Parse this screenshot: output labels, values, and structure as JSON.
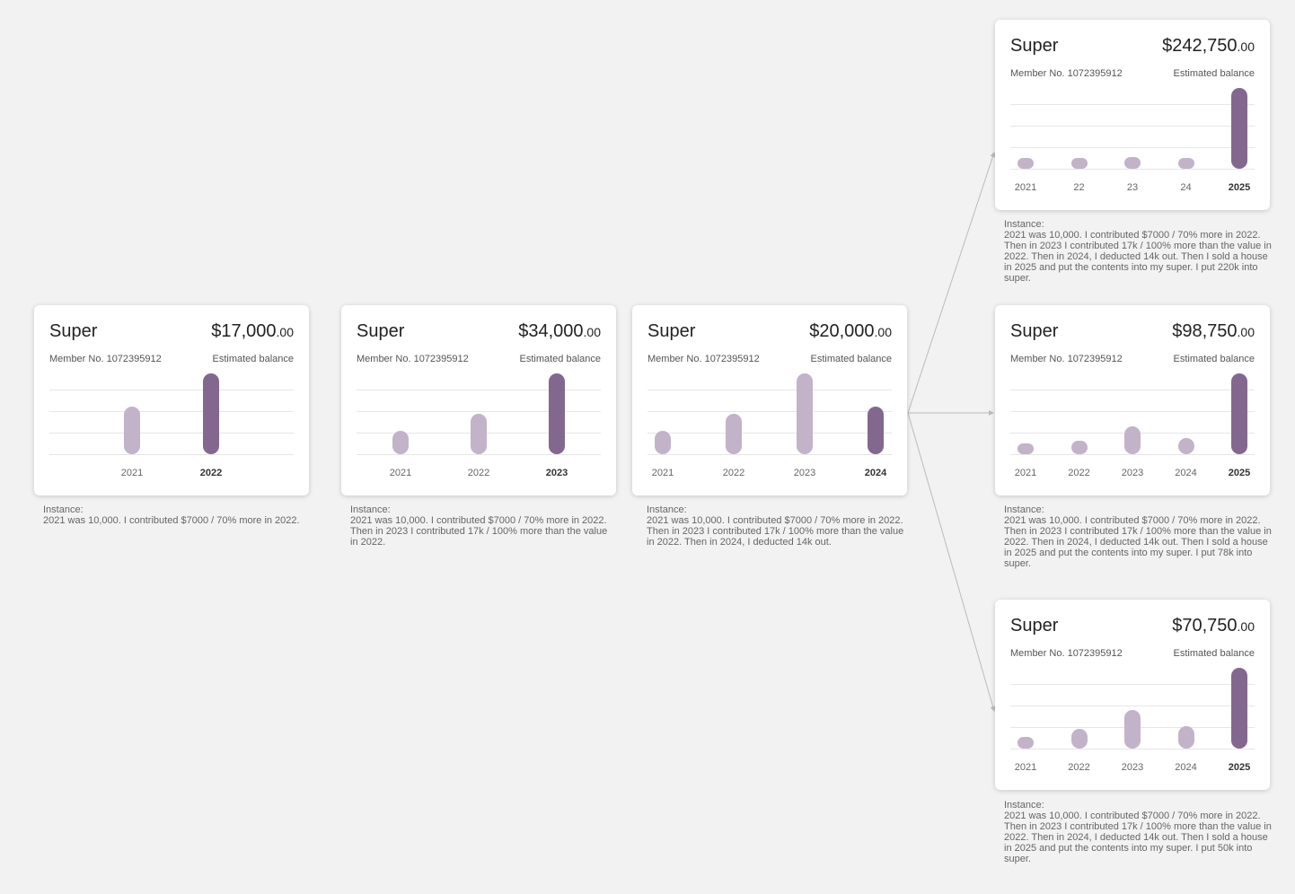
{
  "colors": {
    "bar_past": "#c2b3c9",
    "bar_current": "#82688f",
    "connector": "#bbbbbb"
  },
  "cards": [
    {
      "title": "Super",
      "balance_main": "$17,000",
      "balance_cents": ".00",
      "member": "Member No. 1072395912",
      "estimated": "Estimated balance",
      "note_label": "Instance:",
      "note_text": "2021 was 10,000. I contributed $7000 / 70% more in 2022.",
      "chart_data": {
        "type": "bar",
        "categories": [
          "2021",
          "2022"
        ],
        "values": [
          10000,
          17000
        ]
      }
    },
    {
      "title": "Super",
      "balance_main": "$34,000",
      "balance_cents": ".00",
      "member": "Member No. 1072395912",
      "estimated": "Estimated balance",
      "note_label": "Instance:",
      "note_text": "2021 was 10,000. I contributed $7000 / 70% more in 2022. Then in 2023 I contributed 17k / 100% more than the value in 2022.",
      "chart_data": {
        "type": "bar",
        "categories": [
          "2021",
          "2022",
          "2023"
        ],
        "values": [
          10000,
          17000,
          34000
        ]
      }
    },
    {
      "title": "Super",
      "balance_main": "$20,000",
      "balance_cents": ".00",
      "member": "Member No. 1072395912",
      "estimated": "Estimated balance",
      "note_label": "Instance:",
      "note_text": "2021 was 10,000. I contributed $7000 / 70% more in 2022. Then in 2023 I contributed 17k / 100% more than the value in 2022. Then in 2024, I deducted 14k out.",
      "chart_data": {
        "type": "bar",
        "categories": [
          "2021",
          "2022",
          "2023",
          "2024"
        ],
        "values": [
          10000,
          17000,
          34000,
          20000
        ]
      }
    },
    {
      "title": "Super",
      "balance_main": "$242,750",
      "balance_cents": ".00",
      "member": "Member No. 1072395912",
      "estimated": "Estimated balance",
      "note_label": "Instance:",
      "note_text": "2021 was 10,000. I contributed $7000 / 70% more in 2022. Then in 2023 I contributed 17k / 100% more than the value in 2022. Then in 2024, I deducted 14k out. Then I sold a house in 2025 and put the contents into my super. I put 220k into super.",
      "chart_data": {
        "type": "bar",
        "categories": [
          "2021",
          "22",
          "23",
          "24",
          "2025"
        ],
        "values": [
          10000,
          17000,
          34000,
          20000,
          242750
        ]
      }
    },
    {
      "title": "Super",
      "balance_main": "$98,750",
      "balance_cents": ".00",
      "member": "Member No. 1072395912",
      "estimated": "Estimated balance",
      "note_label": "Instance:",
      "note_text": "2021 was 10,000. I contributed $7000 / 70% more in 2022. Then in 2023 I contributed 17k / 100% more than the value in 2022. Then in 2024, I deducted 14k out. Then I sold a house in 2025 and put the contents into my super. I put 78k into super.",
      "chart_data": {
        "type": "bar",
        "categories": [
          "2021",
          "2022",
          "2023",
          "2024",
          "2025"
        ],
        "values": [
          10000,
          17000,
          34000,
          20000,
          98750
        ]
      }
    },
    {
      "title": "Super",
      "balance_main": "$70,750",
      "balance_cents": ".00",
      "member": "Member No. 1072395912",
      "estimated": "Estimated balance",
      "note_label": "Instance:",
      "note_text": "2021 was 10,000. I contributed $7000 / 70% more in 2022. Then in 2023 I contributed 17k / 100% more than the value in 2022. Then in 2024, I deducted 14k out. Then I sold a house in 2025 and put the contents into my super. I put 50k into super.",
      "chart_data": {
        "type": "bar",
        "categories": [
          "2021",
          "2022",
          "2023",
          "2024",
          "2025"
        ],
        "values": [
          10000,
          17000,
          34000,
          20000,
          70750
        ]
      }
    }
  ]
}
